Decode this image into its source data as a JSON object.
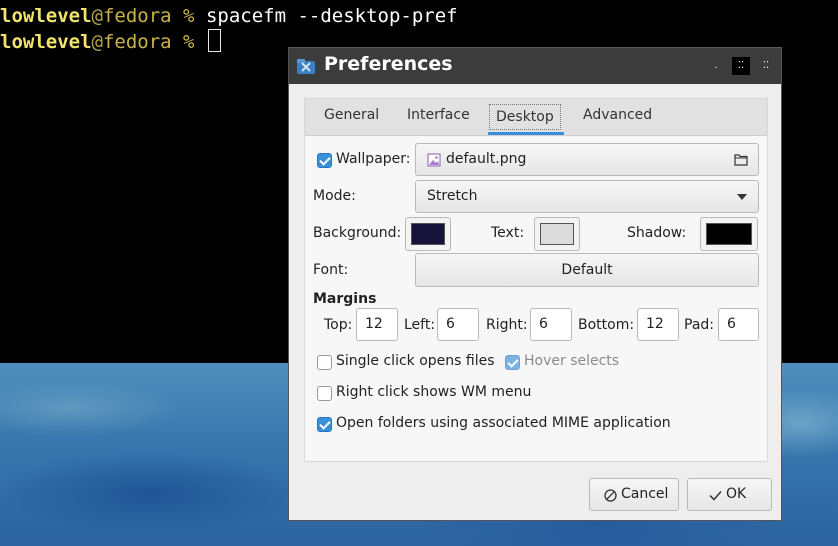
{
  "terminal": {
    "lines": [
      {
        "user": "lowlevel",
        "at": "@",
        "host": "fedora",
        "prompt": " % ",
        "command": "spacefm --desktop-pref"
      },
      {
        "user": "lowlevel",
        "at": "@",
        "host": "fedora",
        "prompt": " % ",
        "command": ""
      }
    ]
  },
  "dialog": {
    "title": "Preferences",
    "tabs": [
      {
        "label": "General"
      },
      {
        "label": "Interface"
      },
      {
        "label": "Desktop"
      },
      {
        "label": "Advanced"
      }
    ],
    "wallpaper": {
      "label": "Wallpaper:",
      "checked": true,
      "file": "default.png"
    },
    "mode": {
      "label": "Mode:",
      "value": "Stretch"
    },
    "colors": {
      "background_label": "Background:",
      "background_color": "#15133a",
      "text_label": "Text:",
      "text_color": "#dcdcdc",
      "shadow_label": "Shadow:",
      "shadow_color": "#000000"
    },
    "font": {
      "label": "Font:",
      "value": "Default"
    },
    "margins": {
      "heading": "Margins",
      "top_label": "Top:",
      "top": "12",
      "left_label": "Left:",
      "left": "6",
      "right_label": "Right:",
      "right": "6",
      "bottom_label": "Bottom:",
      "bottom": "12",
      "pad_label": "Pad:",
      "pad": "6"
    },
    "options": {
      "single_click": {
        "label": "Single click opens files",
        "checked": false
      },
      "hover_selects": {
        "label": "Hover selects",
        "checked": true
      },
      "right_click": {
        "label": "Right click shows WM menu",
        "checked": false
      },
      "open_folders": {
        "label": "Open folders using associated MIME application",
        "checked": true
      }
    },
    "buttons": {
      "cancel": "Cancel",
      "ok": "OK"
    }
  }
}
